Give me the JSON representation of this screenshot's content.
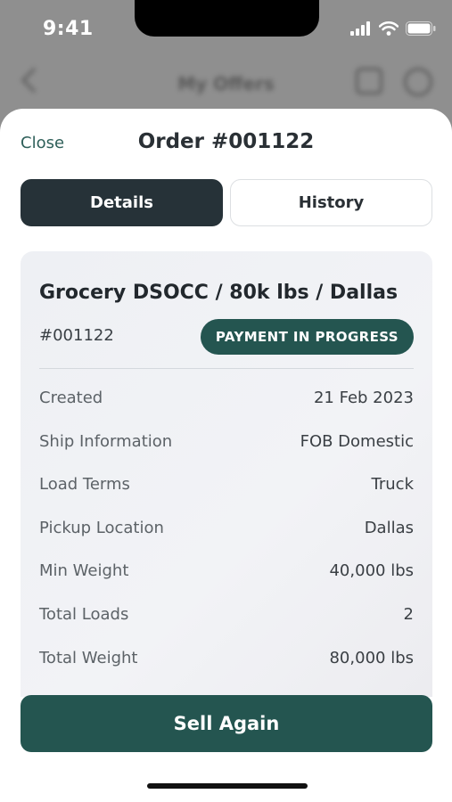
{
  "status_bar": {
    "time": "9:41"
  },
  "background": {
    "title": "My Offers"
  },
  "sheet": {
    "close_label": "Close",
    "title": "Order #001122"
  },
  "tabs": [
    {
      "label": "Details",
      "active": true
    },
    {
      "label": "History",
      "active": false
    }
  ],
  "card": {
    "title": "Grocery DSOCC / 80k lbs / Dallas",
    "order_id": "#001122",
    "status": "PAYMENT IN PROGRESS",
    "rows": [
      {
        "label": "Created",
        "value": "21 Feb 2023"
      },
      {
        "label": "Ship Information",
        "value": "FOB Domestic"
      },
      {
        "label": "Load Terms",
        "value": "Truck"
      },
      {
        "label": "Pickup Location",
        "value": "Dallas"
      },
      {
        "label": "Min Weight",
        "value": "40,000 lbs"
      },
      {
        "label": "Total Loads",
        "value": "2"
      },
      {
        "label": "Total Weight",
        "value": "80,000 lbs"
      }
    ]
  },
  "actions": {
    "sell_again_label": "Sell Again"
  },
  "colors": {
    "accent": "#245550",
    "tab_active": "#263238",
    "close_link": "#2e5f59"
  },
  "icons": {
    "status_bar": [
      "signal-icon",
      "wifi-icon",
      "battery-icon"
    ],
    "header": [
      "back-icon",
      "filter-icon",
      "profile-icon"
    ]
  }
}
